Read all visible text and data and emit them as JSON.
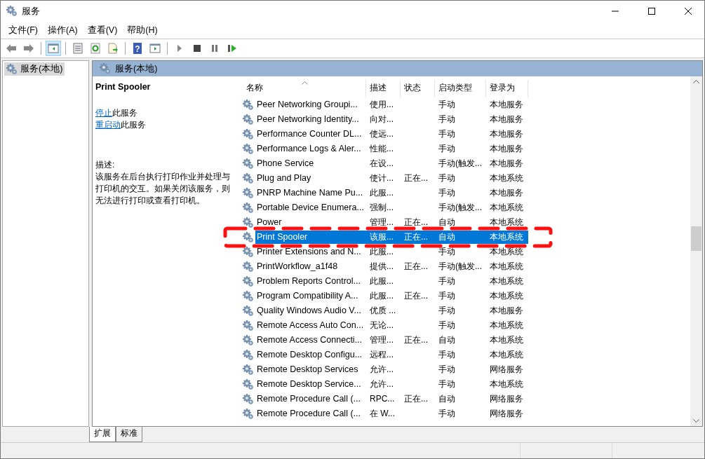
{
  "window": {
    "title": "服务"
  },
  "menu": [
    "文件(F)",
    "操作(A)",
    "查看(V)",
    "帮助(H)"
  ],
  "toolbar": [
    {
      "kind": "back",
      "selected": false
    },
    {
      "kind": "forward",
      "selected": false
    },
    {
      "kind": "sep"
    },
    {
      "kind": "tree",
      "selected": true
    },
    {
      "kind": "sep"
    },
    {
      "kind": "properties",
      "selected": false
    },
    {
      "kind": "refresh",
      "selected": false
    },
    {
      "kind": "export",
      "selected": false
    },
    {
      "kind": "sep"
    },
    {
      "kind": "help",
      "glyph": "?",
      "selected": false
    },
    {
      "kind": "pane",
      "selected": false
    },
    {
      "kind": "sep"
    },
    {
      "kind": "play",
      "selected": false
    },
    {
      "kind": "stop",
      "selected": false
    },
    {
      "kind": "pause",
      "selected": false
    },
    {
      "kind": "restart",
      "selected": false
    }
  ],
  "tree": [
    {
      "label": "服务(本地)",
      "selected": true
    }
  ],
  "panel": {
    "title": "服务(本地)"
  },
  "detail": {
    "title": "Print Spooler",
    "actions": [
      {
        "link": "停止",
        "rest": "此服务"
      },
      {
        "link": "重启动",
        "rest": "此服务"
      }
    ],
    "description_label": "描述:",
    "description": "该服务在后台执行打印作业并处理与打印机的交互。如果关闭该服务，则无法进行打印或查看打印机。"
  },
  "table": {
    "columns": [
      {
        "label": "名称",
        "sorted": true
      },
      {
        "label": "描述",
        "sorted": false
      },
      {
        "label": "状态",
        "sorted": false
      },
      {
        "label": "启动类型",
        "sorted": false
      },
      {
        "label": "登录为",
        "sorted": false
      }
    ],
    "rows": [
      {
        "name": "Peer Networking Groupi...",
        "desc": "使用...",
        "status": "",
        "startup": "手动",
        "logon": "本地服务",
        "selected": false
      },
      {
        "name": "Peer Networking Identity...",
        "desc": "向对...",
        "status": "",
        "startup": "手动",
        "logon": "本地服务",
        "selected": false
      },
      {
        "name": "Performance Counter DL...",
        "desc": "使远...",
        "status": "",
        "startup": "手动",
        "logon": "本地服务",
        "selected": false
      },
      {
        "name": "Performance Logs & Aler...",
        "desc": "性能...",
        "status": "",
        "startup": "手动",
        "logon": "本地服务",
        "selected": false
      },
      {
        "name": "Phone Service",
        "desc": "在设...",
        "status": "",
        "startup": "手动(触发...",
        "logon": "本地服务",
        "selected": false
      },
      {
        "name": "Plug and Play",
        "desc": "使计...",
        "status": "正在...",
        "startup": "手动",
        "logon": "本地系统",
        "selected": false
      },
      {
        "name": "PNRP Machine Name Pu...",
        "desc": "此服...",
        "status": "",
        "startup": "手动",
        "logon": "本地服务",
        "selected": false
      },
      {
        "name": "Portable Device Enumera...",
        "desc": "强制...",
        "status": "",
        "startup": "手动(触发...",
        "logon": "本地系统",
        "selected": false
      },
      {
        "name": "Power",
        "desc": "管理...",
        "status": "正在...",
        "startup": "自动",
        "logon": "本地系统",
        "selected": false
      },
      {
        "name": "Print Spooler",
        "desc": "该服...",
        "status": "正在...",
        "startup": "自动",
        "logon": "本地系统",
        "selected": true
      },
      {
        "name": "Printer Extensions and N...",
        "desc": "此服...",
        "status": "",
        "startup": "手动",
        "logon": "本地系统",
        "selected": false
      },
      {
        "name": "PrintWorkflow_a1f48",
        "desc": "提供...",
        "status": "正在...",
        "startup": "手动(触发...",
        "logon": "本地系统",
        "selected": false
      },
      {
        "name": "Problem Reports Control...",
        "desc": "此服...",
        "status": "",
        "startup": "手动",
        "logon": "本地系统",
        "selected": false
      },
      {
        "name": "Program Compatibility A...",
        "desc": "此服...",
        "status": "正在...",
        "startup": "手动",
        "logon": "本地系统",
        "selected": false
      },
      {
        "name": "Quality Windows Audio V...",
        "desc": "优质 ...",
        "status": "",
        "startup": "手动",
        "logon": "本地服务",
        "selected": false
      },
      {
        "name": "Remote Access Auto Con...",
        "desc": "无论...",
        "status": "",
        "startup": "手动",
        "logon": "本地系统",
        "selected": false
      },
      {
        "name": "Remote Access Connecti...",
        "desc": "管理...",
        "status": "正在...",
        "startup": "自动",
        "logon": "本地系统",
        "selected": false
      },
      {
        "name": "Remote Desktop Configu...",
        "desc": "远程...",
        "status": "",
        "startup": "手动",
        "logon": "本地系统",
        "selected": false
      },
      {
        "name": "Remote Desktop Services",
        "desc": "允许...",
        "status": "",
        "startup": "手动",
        "logon": "网络服务",
        "selected": false
      },
      {
        "name": "Remote Desktop Service...",
        "desc": "允许...",
        "status": "",
        "startup": "手动",
        "logon": "本地系统",
        "selected": false
      },
      {
        "name": "Remote Procedure Call (...",
        "desc": "RPC...",
        "status": "正在...",
        "startup": "自动",
        "logon": "网络服务",
        "selected": false
      },
      {
        "name": "Remote Procedure Call (...",
        "desc": "在 W...",
        "status": "",
        "startup": "手动",
        "logon": "网络服务",
        "selected": false
      }
    ]
  },
  "annotation": {
    "kind": "dashed-rectangle"
  },
  "tabs": [
    {
      "label": "扩展",
      "selected": true
    },
    {
      "label": "标准",
      "selected": false
    }
  ]
}
